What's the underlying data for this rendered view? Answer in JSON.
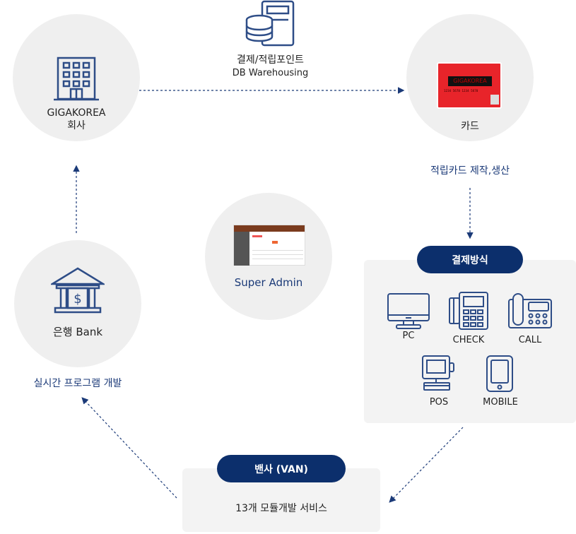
{
  "colors": {
    "navy": "#0c2f6c",
    "icon": "#2e4d87",
    "circle": "#efefef",
    "box": "#f3f3f3",
    "card_red": "#e8242a"
  },
  "db": {
    "line1": "결제/적립포인트",
    "line2": "DB Warehousing",
    "icon": "database-server-icon"
  },
  "company": {
    "line1": "GIGAKOREA",
    "line2": "회사",
    "icon": "office-building-icon"
  },
  "card": {
    "label": "카드",
    "caption": "적립카드 제작,생산",
    "card_brand": "GIGAKOREA",
    "card_numbers": "1234  5678  1234  5678"
  },
  "admin": {
    "label": "Super Admin"
  },
  "bank": {
    "label": "은행 Bank",
    "caption": "실시간 프로그램 개발",
    "icon": "bank-icon"
  },
  "payment": {
    "title": "결제방식",
    "items": [
      {
        "label": "PC",
        "icon": "monitor-icon"
      },
      {
        "label": "CHECK",
        "icon": "card-terminal-icon"
      },
      {
        "label": "CALL",
        "icon": "telephone-icon"
      },
      {
        "label": "POS",
        "icon": "pos-icon"
      },
      {
        "label": "MOBILE",
        "icon": "mobile-icon"
      }
    ]
  },
  "van": {
    "title": "밴사 (VAN)",
    "desc": "13개 모듈개발 서비스"
  }
}
